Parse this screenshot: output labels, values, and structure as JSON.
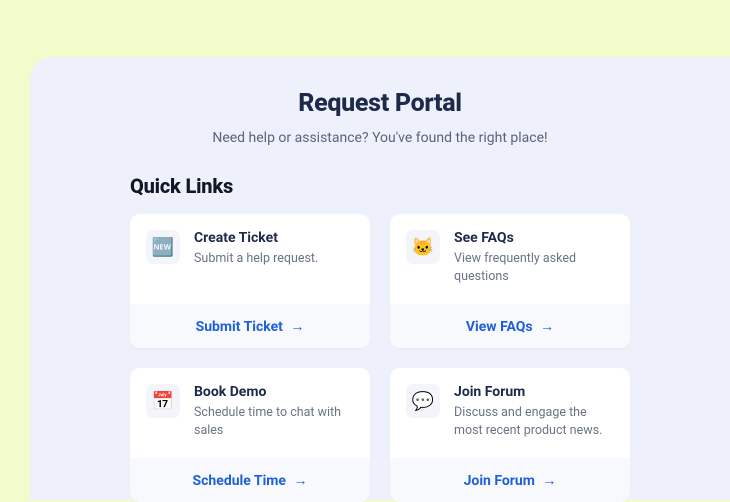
{
  "header": {
    "title": "Request Portal",
    "subtitle": "Need help or assistance? You've found the right place!"
  },
  "quicklinks": {
    "heading": "Quick Links",
    "cards": [
      {
        "icon": "🆕",
        "title": "Create Ticket",
        "desc": "Submit a help request.",
        "action": "Submit Ticket"
      },
      {
        "icon": "🐱",
        "title": "See FAQs",
        "desc": "View frequently asked questions",
        "action": "View FAQs"
      },
      {
        "icon": "📅",
        "title": "Book Demo",
        "desc": "Schedule time to chat with sales",
        "action": "Schedule Time"
      },
      {
        "icon": "💬",
        "title": "Join Forum",
        "desc": "Discuss and engage the most recent product news.",
        "action": "Join Forum"
      }
    ]
  },
  "arrow_glyph": "→"
}
